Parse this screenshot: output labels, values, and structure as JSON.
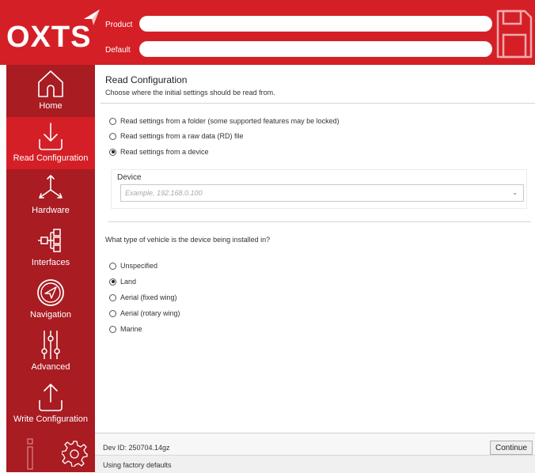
{
  "header": {
    "logo_text": "OXTS",
    "product_label": "Product",
    "product_value": "",
    "default_label": "Default",
    "default_value": "",
    "save_icon": "floppy-disk-icon"
  },
  "sidebar": {
    "items": [
      {
        "label": "Home",
        "icon": "home-icon"
      },
      {
        "label": "Read Configuration",
        "icon": "download-arrow-icon"
      },
      {
        "label": "Hardware",
        "icon": "axes-icon"
      },
      {
        "label": "Interfaces",
        "icon": "connector-icon"
      },
      {
        "label": "Navigation",
        "icon": "compass-icon"
      },
      {
        "label": "Advanced",
        "icon": "sliders-icon"
      },
      {
        "label": "Write Configuration",
        "icon": "upload-arrow-icon"
      }
    ],
    "bottom": {
      "info_icon": "info-icon",
      "settings_icon": "gear-icon"
    }
  },
  "main": {
    "title": "Read Configuration",
    "subtitle": "Choose where the initial settings should be read from.",
    "source_options": [
      {
        "label": "Read settings from a folder (some supported features may be locked)",
        "checked": false
      },
      {
        "label": "Read settings from a raw data (RD) file",
        "checked": false
      },
      {
        "label": "Read settings from a device",
        "checked": true
      }
    ],
    "device": {
      "label": "Device",
      "placeholder": "Example, 192.168.0.100",
      "value": ""
    },
    "vehicle_question": "What type of vehicle is the device being installed in?",
    "vehicle_options": [
      {
        "label": "Unspecified",
        "checked": false
      },
      {
        "label": "Land",
        "checked": true
      },
      {
        "label": "Aerial (fixed wing)",
        "checked": false
      },
      {
        "label": "Aerial (rotary wing)",
        "checked": false
      },
      {
        "label": "Marine",
        "checked": false
      }
    ],
    "status": {
      "dev_id": "Dev ID: 250704.14gz",
      "continue_label": "Continue",
      "factory_text": "Using factory defaults"
    }
  },
  "colors": {
    "brand_red": "#d51f26",
    "sidebar_red": "#a81c22"
  }
}
